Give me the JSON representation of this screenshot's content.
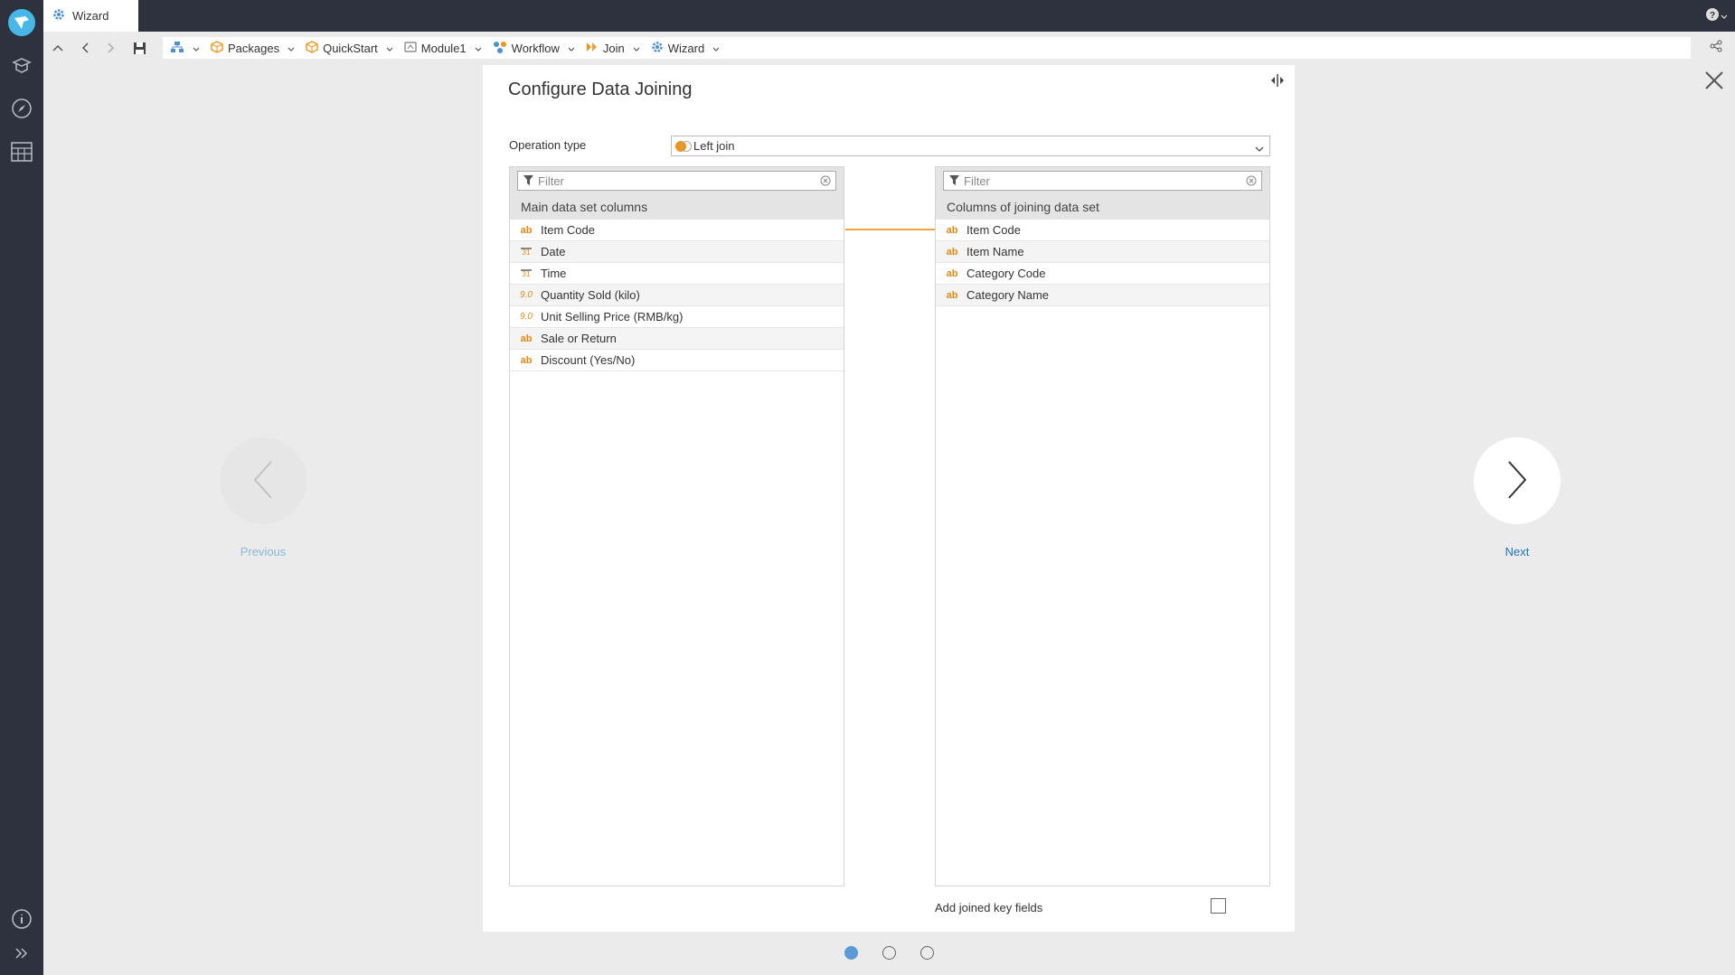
{
  "tab": {
    "title": "Wizard"
  },
  "breadcrumb": [
    {
      "label": "",
      "icon": "hierarchy-icon"
    },
    {
      "label": "Packages",
      "icon": "package-icon"
    },
    {
      "label": "QuickStart",
      "icon": "package-icon"
    },
    {
      "label": "Module1",
      "icon": "module-icon"
    },
    {
      "label": "Workflow",
      "icon": "workflow-icon"
    },
    {
      "label": "Join",
      "icon": "join-icon"
    },
    {
      "label": "Wizard",
      "icon": "gear-icon"
    }
  ],
  "panel": {
    "title": "Configure Data Joining",
    "operation_label": "Operation type",
    "operation_value": "Left join",
    "left": {
      "filter_placeholder": "Filter",
      "header": "Main data set columns",
      "columns": [
        {
          "type": "ab",
          "name": "Item Code"
        },
        {
          "type": "31",
          "name": "Date"
        },
        {
          "type": "31",
          "name": "Time"
        },
        {
          "type": "9.0",
          "name": "Quantity Sold (kilo)"
        },
        {
          "type": "9.0",
          "name": "Unit Selling Price (RMB/kg)"
        },
        {
          "type": "ab",
          "name": "Sale or Return"
        },
        {
          "type": "ab",
          "name": "Discount (Yes/No)"
        }
      ]
    },
    "right": {
      "filter_placeholder": "Filter",
      "header": "Columns of joining data set",
      "columns": [
        {
          "type": "ab",
          "name": "Item Code"
        },
        {
          "type": "ab",
          "name": "Item Name"
        },
        {
          "type": "ab",
          "name": "Category Code"
        },
        {
          "type": "ab",
          "name": "Category Name"
        }
      ]
    },
    "add_key_fields_label": "Add joined key fields",
    "add_key_fields_checked": false
  },
  "nav": {
    "previous": "Previous",
    "next": "Next"
  },
  "pager": {
    "total": 3,
    "current": 1
  },
  "colors": {
    "accent": "#f29412",
    "rail": "#2e323e",
    "link": "#1e73be"
  }
}
